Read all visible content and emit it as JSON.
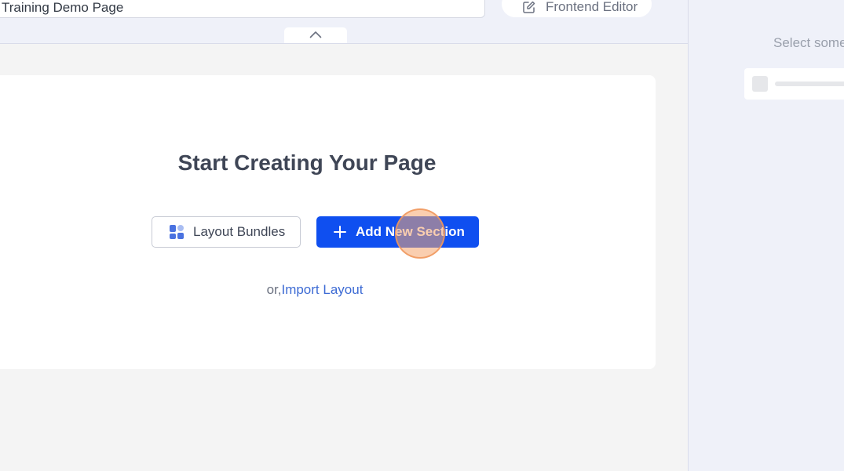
{
  "header": {
    "page_title_value": "Training Demo Page",
    "frontend_editor_label": "Frontend Editor"
  },
  "canvas": {
    "heading": "Start Creating Your Page",
    "layout_bundles_label": "Layout Bundles",
    "add_section_label": "Add New Section",
    "import_prefix": "or,",
    "import_link_label": "Import Layout"
  },
  "side_panel": {
    "hint": "Select some"
  },
  "colors": {
    "accent": "#0f4ff0",
    "link": "#3d6bd4"
  },
  "icons": {
    "frontend_editor": "edit-icon",
    "collapse": "chevron-up-icon",
    "layout_bundles": "blocks-icon",
    "add_section": "plus-icon"
  }
}
